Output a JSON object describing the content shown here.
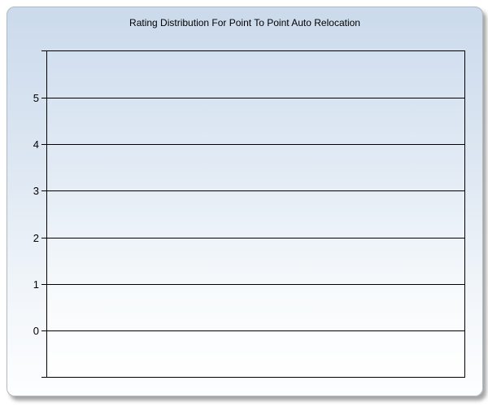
{
  "chart_data": {
    "type": "bar",
    "title": "Rating Distribution For Point To Point Auto Relocation",
    "categories": [],
    "series": [],
    "values": [],
    "xlabel": "",
    "ylabel": "",
    "y_ticks": [
      5,
      4,
      3,
      2,
      1,
      0
    ],
    "ylim": [
      -1,
      6
    ],
    "grid": "horizontal",
    "legend": "none"
  },
  "colors": {
    "panel_gradient_top": "#cbdaec",
    "panel_gradient_bottom": "#fdfeff",
    "plot_gradient_top": "#d2dfef",
    "plot_gradient_bottom": "#ffffff",
    "gridline": "#000000",
    "axis": "#000000",
    "text": "#000000",
    "panel_border": "#b0b8c2"
  }
}
